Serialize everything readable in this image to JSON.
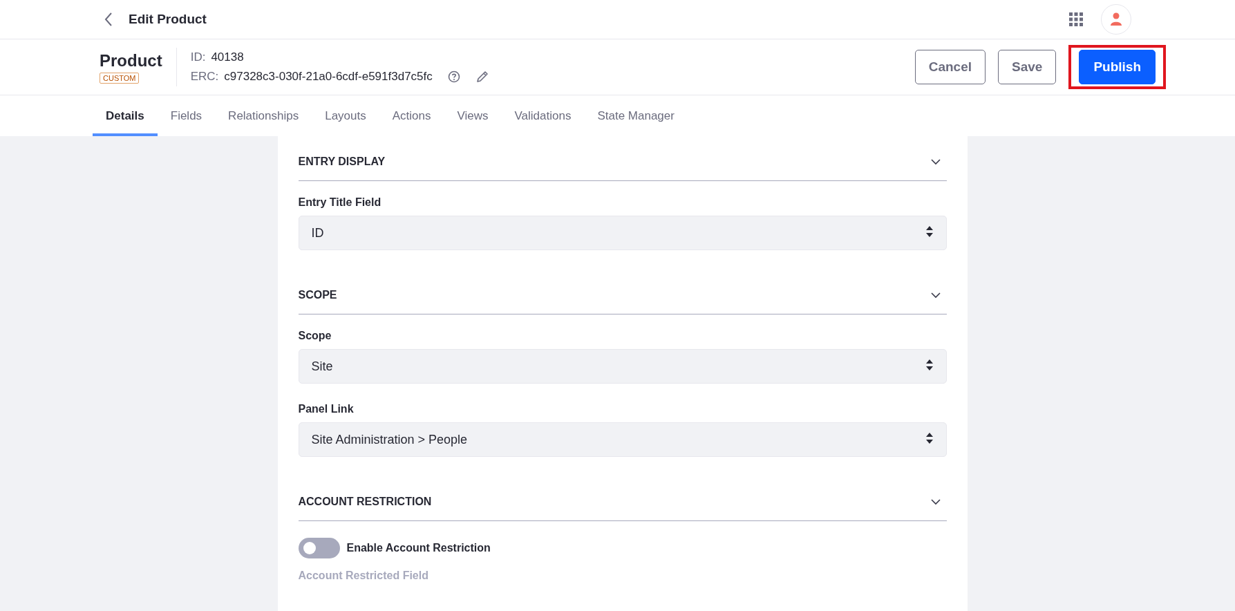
{
  "top_bar": {
    "title": "Edit Product"
  },
  "header": {
    "name": "Product",
    "badge": "CUSTOM",
    "id_label": "ID:",
    "id_value": "40138",
    "erc_label": "ERC:",
    "erc_value": "c97328c3-030f-21a0-6cdf-e591f3d7c5fc",
    "buttons": [
      {
        "label": "Cancel",
        "kind": "secondary",
        "highlighted": false
      },
      {
        "label": "Save",
        "kind": "secondary",
        "highlighted": false
      },
      {
        "label": "Publish",
        "kind": "primary",
        "highlighted": true
      }
    ]
  },
  "tabs": [
    {
      "label": "Details",
      "selected": true
    },
    {
      "label": "Fields",
      "selected": false
    },
    {
      "label": "Relationships",
      "selected": false
    },
    {
      "label": "Layouts",
      "selected": false
    },
    {
      "label": "Actions",
      "selected": false
    },
    {
      "label": "Views",
      "selected": false
    },
    {
      "label": "Validations",
      "selected": false
    },
    {
      "label": "State Manager",
      "selected": false
    }
  ],
  "sections": [
    {
      "title": "ENTRY DISPLAY",
      "expanded": true,
      "items": [
        {
          "kind": "select",
          "label": "Entry Title Field",
          "value": "ID"
        }
      ]
    },
    {
      "title": "SCOPE",
      "expanded": true,
      "items": [
        {
          "kind": "select",
          "label": "Scope",
          "value": "Site"
        },
        {
          "kind": "select",
          "label": "Panel Link",
          "value": "Site Administration > People"
        }
      ]
    },
    {
      "title": "ACCOUNT RESTRICTION",
      "expanded": true,
      "items": [
        {
          "kind": "toggle",
          "label": "Enable Account Restriction",
          "on": false
        },
        {
          "kind": "label",
          "label": "Account Restricted Field",
          "disabled": true
        }
      ]
    }
  ]
}
